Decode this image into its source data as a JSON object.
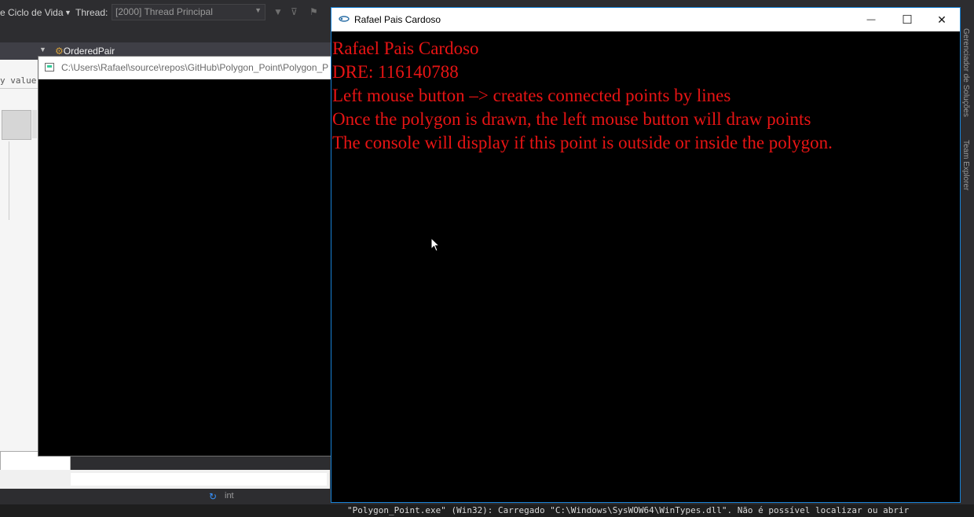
{
  "ide": {
    "toolbar": {
      "lifecycle": "e Ciclo de Vida",
      "thread_label": "Thread:",
      "thread_value": "[2000] Thread Principal"
    },
    "nav": {
      "member": "OrderedPair"
    },
    "left_fragment": "y value",
    "status": {
      "type": "int"
    },
    "output_line": "\"Polygon_Point.exe\" (Win32): Carregado \"C:\\Windows\\SysWOW64\\WinTypes.dll\". Não é possível localizar ou abrir",
    "side_tabs": [
      "Gerenciador de Soluções",
      "Team Explorer"
    ]
  },
  "console_window": {
    "title": "C:\\Users\\Rafael\\source\\repos\\GitHub\\Polygon_Point\\Polygon_Point"
  },
  "glut_window": {
    "title": "Rafael Pais Cardoso",
    "lines": [
      "Rafael Pais Cardoso",
      "DRE: 116140788",
      "Left mouse button –> creates connected points by lines",
      "Once the polygon is drawn, the left mouse button will draw points",
      "The console will display if this point is outside or inside the polygon."
    ],
    "text_color": "#e81414",
    "controls": {
      "minimize": "—",
      "maximize": "☐",
      "close": "✕"
    }
  }
}
